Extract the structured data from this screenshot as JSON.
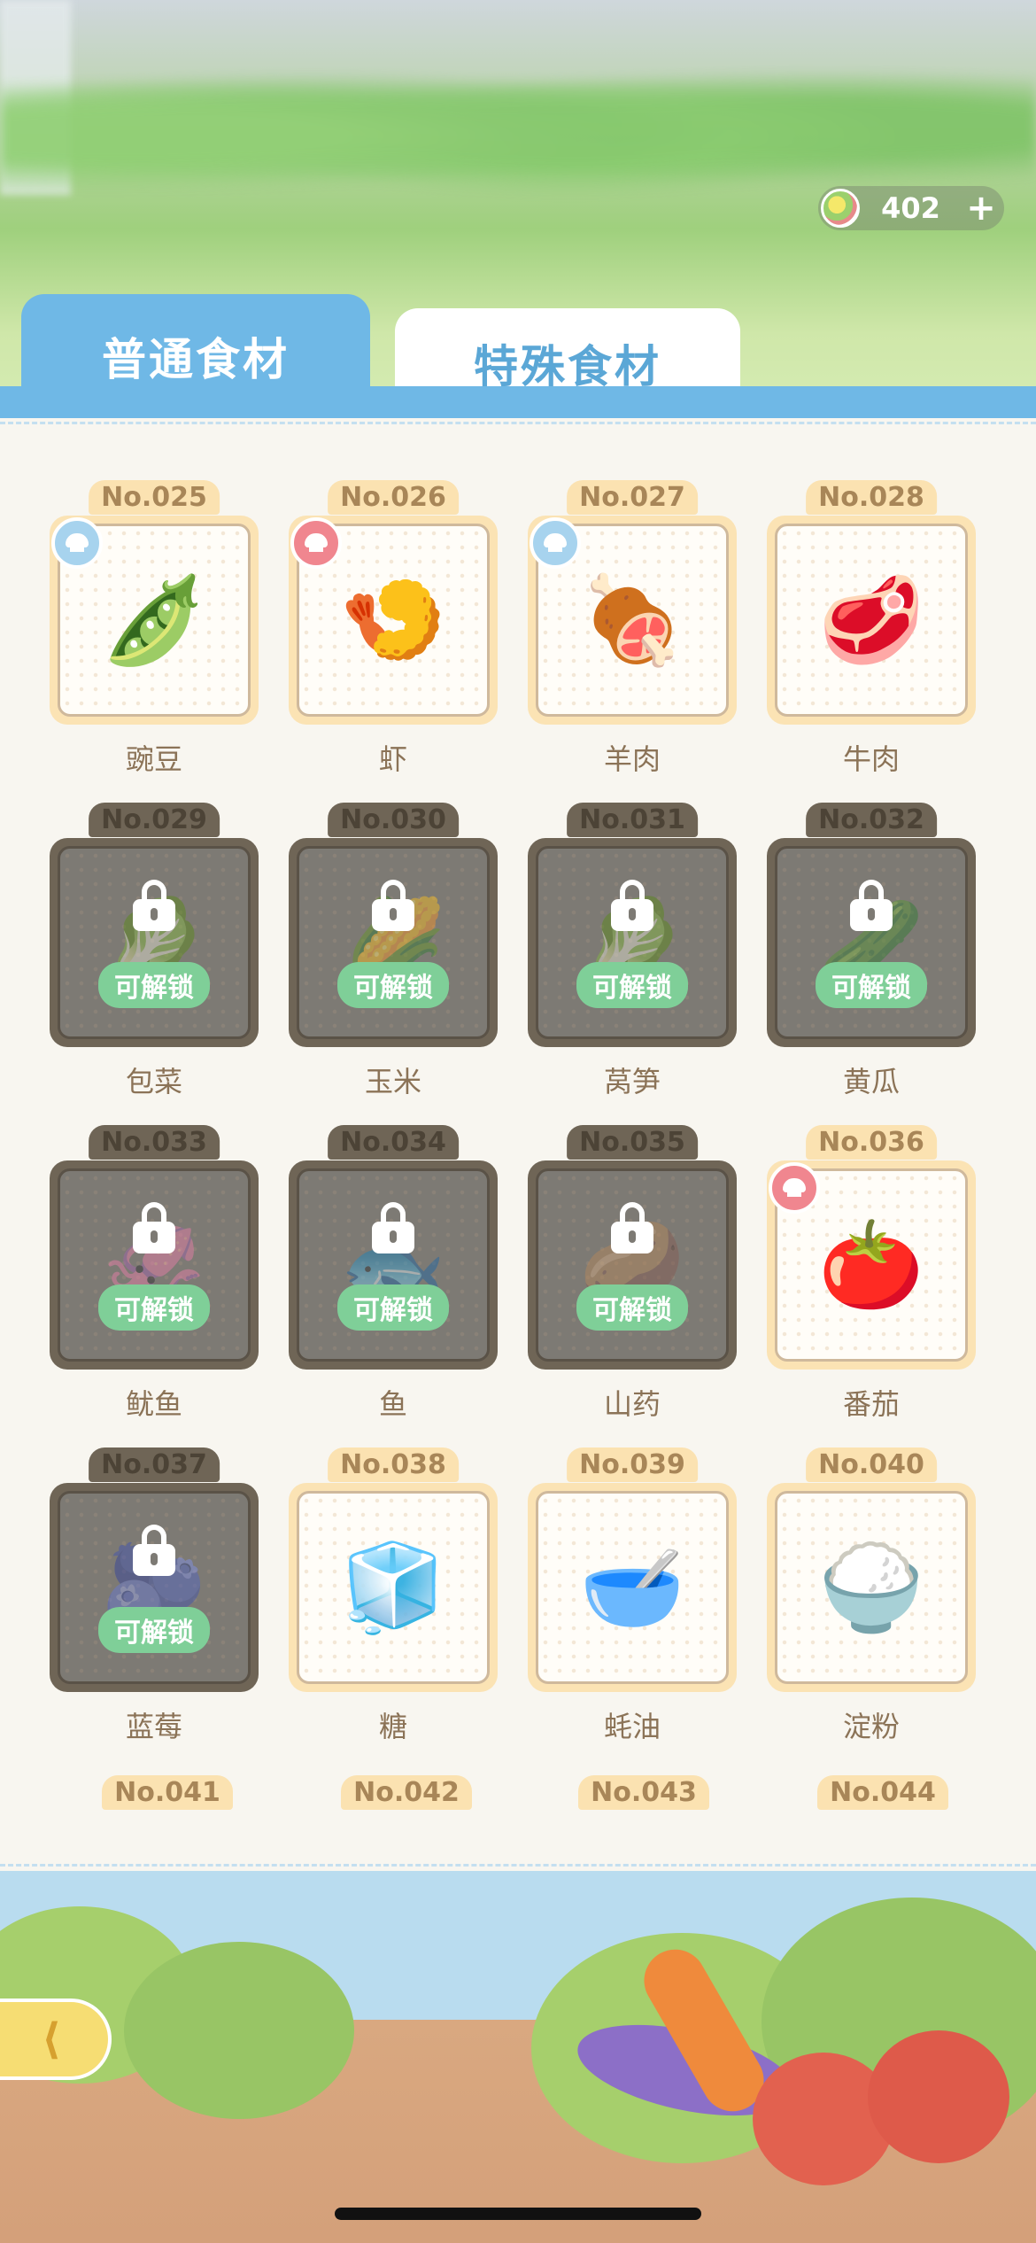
{
  "currency": {
    "amount": "402",
    "plus_symbol": "+"
  },
  "tabs": [
    {
      "label": "普通食材",
      "active": true
    },
    {
      "label": "特殊食材",
      "active": false
    }
  ],
  "unlock_text": "可解锁",
  "items": [
    {
      "no": "No.025",
      "name": "豌豆",
      "locked": false,
      "badge": "blue",
      "icon": "peapod-icon",
      "glyph": "🫛"
    },
    {
      "no": "No.026",
      "name": "虾",
      "locked": false,
      "badge": "red",
      "icon": "shrimp-icon",
      "glyph": "🍤"
    },
    {
      "no": "No.027",
      "name": "羊肉",
      "locked": false,
      "badge": "blue",
      "icon": "lamb-icon",
      "glyph": "🍖"
    },
    {
      "no": "No.028",
      "name": "牛肉",
      "locked": false,
      "badge": null,
      "icon": "beef-icon",
      "glyph": "🥩"
    },
    {
      "no": "No.029",
      "name": "包菜",
      "locked": true,
      "badge": null,
      "icon": "cabbage-icon",
      "glyph": "🥬"
    },
    {
      "no": "No.030",
      "name": "玉米",
      "locked": true,
      "badge": null,
      "icon": "corn-icon",
      "glyph": "🌽"
    },
    {
      "no": "No.031",
      "name": "莴笋",
      "locked": true,
      "badge": null,
      "icon": "lettuce-icon",
      "glyph": "🥬"
    },
    {
      "no": "No.032",
      "name": "黄瓜",
      "locked": true,
      "badge": null,
      "icon": "cucumber-icon",
      "glyph": "🥒"
    },
    {
      "no": "No.033",
      "name": "鱿鱼",
      "locked": true,
      "badge": null,
      "icon": "squid-icon",
      "glyph": "🦑"
    },
    {
      "no": "No.034",
      "name": "鱼",
      "locked": true,
      "badge": null,
      "icon": "fish-icon",
      "glyph": "🐟"
    },
    {
      "no": "No.035",
      "name": "山药",
      "locked": true,
      "badge": null,
      "icon": "yam-icon",
      "glyph": "🥔"
    },
    {
      "no": "No.036",
      "name": "番茄",
      "locked": false,
      "badge": "red",
      "icon": "tomato-icon",
      "glyph": "🍅"
    },
    {
      "no": "No.037",
      "name": "蓝莓",
      "locked": true,
      "badge": null,
      "icon": "blueberry-icon",
      "glyph": "🫐"
    },
    {
      "no": "No.038",
      "name": "糖",
      "locked": false,
      "badge": null,
      "icon": "sugar-icon",
      "glyph": "🧊"
    },
    {
      "no": "No.039",
      "name": "蚝油",
      "locked": false,
      "badge": null,
      "icon": "oyster-sauce-icon",
      "glyph": "🥣"
    },
    {
      "no": "No.040",
      "name": "淀粉",
      "locked": false,
      "badge": null,
      "icon": "starch-icon",
      "glyph": "🍚"
    }
  ],
  "partial_items": [
    "No.041",
    "No.042",
    "No.043",
    "No.044"
  ],
  "back_button": {
    "glyph": "⟨"
  },
  "colors": {
    "tab_blue": "#6fb8e6",
    "tag_cream": "#fbe2b1",
    "locked_gray": "#6f6556",
    "unlock_green": "#7fcf98"
  }
}
